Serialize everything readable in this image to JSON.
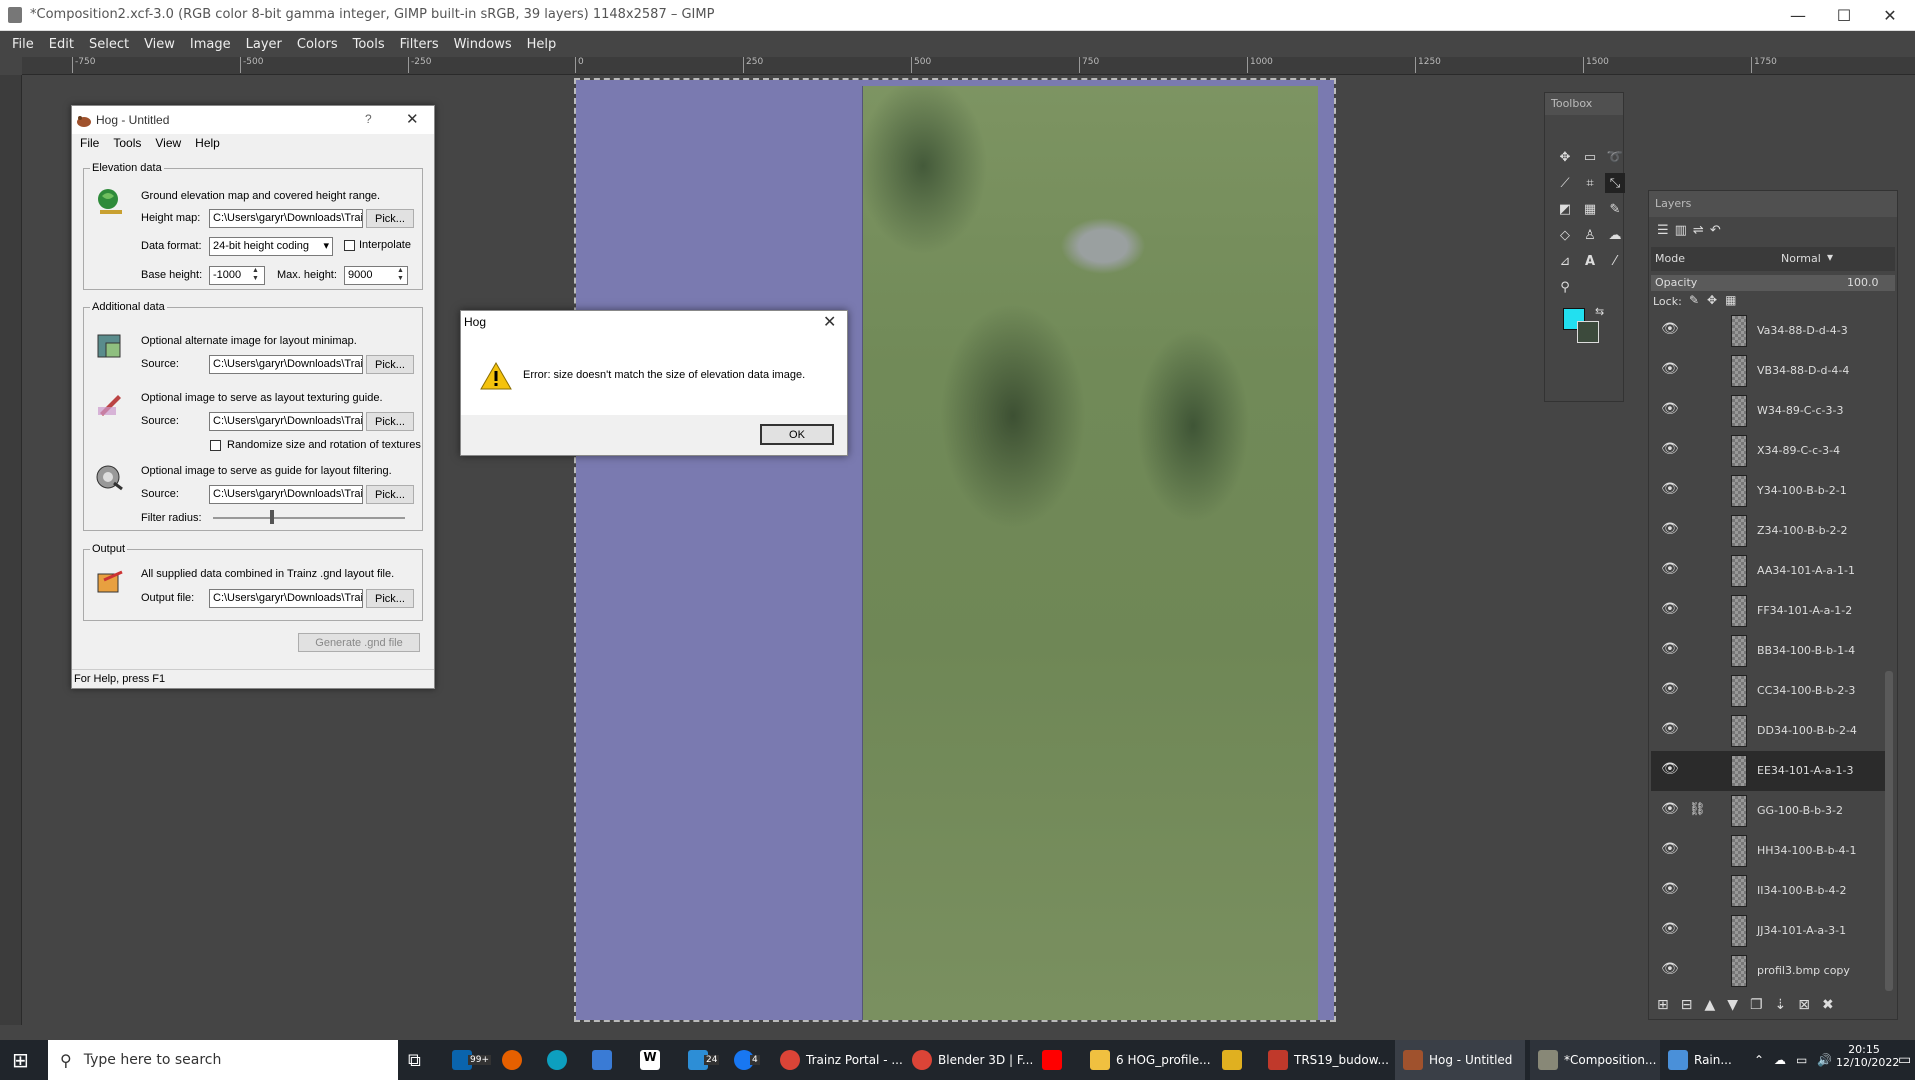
{
  "window": {
    "title": "*Composition2.xcf-3.0 (RGB color 8-bit gamma integer, GIMP built-in sRGB, 39 layers) 1148x2587 – GIMP"
  },
  "menu": [
    "File",
    "Edit",
    "Select",
    "View",
    "Image",
    "Layer",
    "Colors",
    "Tools",
    "Filters",
    "Windows",
    "Help"
  ],
  "ruler_ticks": [
    "-750",
    "-500",
    "-250",
    "0",
    "250",
    "500",
    "750",
    "1000",
    "1250",
    "1500",
    "1750"
  ],
  "hog": {
    "title": "Hog - Untitled",
    "help_btn": "?",
    "close_btn": "✕",
    "menu": [
      "File",
      "Tools",
      "View",
      "Help"
    ],
    "elevation": {
      "legend": "Elevation data",
      "desc": "Ground elevation map and covered height range.",
      "height_map_label": "Height map:",
      "height_map_value": "C:\\Users\\garyr\\Downloads\\Trai",
      "pick": "Pick...",
      "data_format_label": "Data format:",
      "data_format_value": "24-bit height coding",
      "interpolate": "Interpolate",
      "base_height_label": "Base height:",
      "base_height_value": "-1000",
      "max_height_label": "Max. height:",
      "max_height_value": "9000"
    },
    "additional": {
      "legend": "Additional data",
      "minimap_desc": "Optional alternate image for layout minimap.",
      "source_label": "Source:",
      "minimap_source": "C:\\Users\\garyr\\Downloads\\Trai",
      "texture_desc": "Optional image to serve as layout texturing guide.",
      "texture_source": "C:\\Users\\garyr\\Downloads\\Trai",
      "randomize": "Randomize size and rotation of textures",
      "filter_desc": "Optional image to serve as guide for layout filtering.",
      "filter_source": "C:\\Users\\garyr\\Downloads\\Trai",
      "filter_radius_label": "Filter radius:",
      "filter_radius_level": 0.3,
      "pick": "Pick..."
    },
    "output": {
      "legend": "Output",
      "desc": "All supplied data combined in Trainz .gnd layout file.",
      "file_label": "Output file:",
      "file_value": "C:\\Users\\garyr\\Downloads\\Trai",
      "pick": "Pick...",
      "generate": "Generate .gnd file"
    },
    "status": "For Help, press F1"
  },
  "error": {
    "title": "Hog",
    "close_btn": "✕",
    "message": "Error: size doesn't match the size of elevation data image.",
    "ok": "OK"
  },
  "toolbox": {
    "title": "Toolbox"
  },
  "layers": {
    "title": "Layers",
    "mode_label": "Mode",
    "mode_value": "Normal",
    "opacity_label": "Opacity",
    "opacity_value": "100.0",
    "lock_label": "Lock:",
    "items": [
      "Va34-88-D-d-4-3",
      "VB34-88-D-d-4-4",
      "W34-89-C-c-3-3",
      "X34-89-C-c-3-4",
      "Y34-100-B-b-2-1",
      "Z34-100-B-b-2-2",
      "AA34-101-A-a-1-1",
      "FF34-101-A-a-1-2",
      "BB34-100-B-b-1-4",
      "CC34-100-B-b-2-3",
      "DD34-100-B-b-2-4",
      "EE34-101-A-a-1-3",
      "GG-100-B-b-3-2",
      "HH34-100-B-b-4-1",
      "II34-100-B-b-4-2",
      "JJ34-101-A-a-3-1",
      "profil3.bmp copy"
    ],
    "selected_index": 11
  },
  "taskbar": {
    "search_placeholder": "Type here to search",
    "badge_mail": "99+",
    "badge_chat": "24",
    "badge_fb": "4",
    "items": [
      "Trainz Portal - ...",
      "Blender 3D | F...",
      "6 HOG_profile...",
      "TRS19_budow...",
      "Hog - Untitled",
      "*Composition...",
      "Rain..."
    ],
    "time": "20:15",
    "date": "12/10/2022"
  }
}
